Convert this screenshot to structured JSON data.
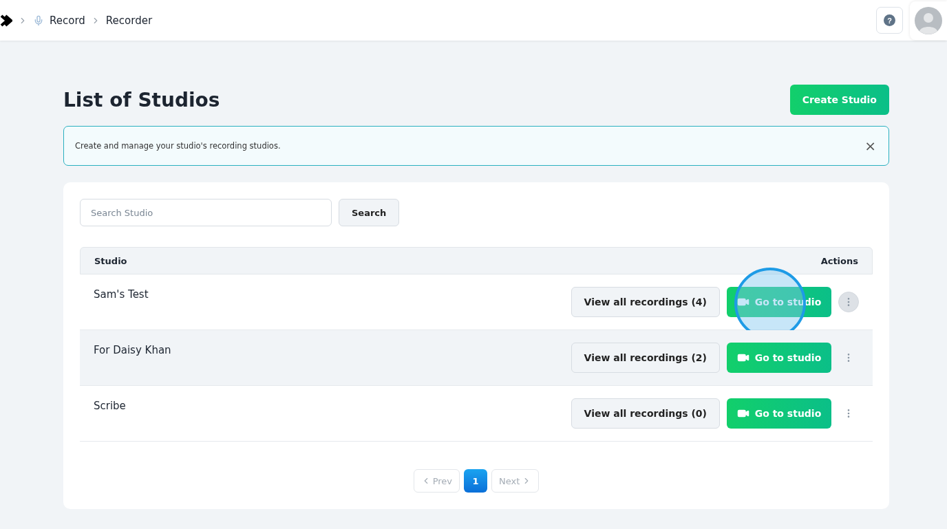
{
  "breadcrumb": [
    {
      "label": "Record",
      "icon": true
    },
    {
      "label": "Recorder",
      "icon": false
    }
  ],
  "header": {
    "help_label": "?"
  },
  "page": {
    "title": "List of Studios",
    "create_button": "Create Studio"
  },
  "info_banner": {
    "text": "Create and manage your studio's recording studios.",
    "close": "×"
  },
  "search": {
    "placeholder": "Search Studio",
    "button": "Search"
  },
  "table": {
    "columns": [
      "Studio",
      "Actions"
    ],
    "rows": [
      {
        "name": "Sam's Test",
        "view_button": "View all recordings (4)",
        "go_button": "Go to studio",
        "menu_active": true,
        "clicked": true
      },
      {
        "name": "For Daisy Khan",
        "view_button": "View all recordings (2)",
        "go_button": "Go to studio",
        "menu_active": false,
        "clicked": false
      },
      {
        "name": "Scribe",
        "view_button": "View all recordings (0)",
        "go_button": "Go to studio",
        "menu_active": false,
        "clicked": false
      }
    ]
  },
  "pagination": {
    "prev": {
      "label": "Prev",
      "disabled": true
    },
    "pages": [
      {
        "label": "1",
        "selected": true
      }
    ],
    "next": {
      "label": "Next",
      "disabled": true
    }
  }
}
